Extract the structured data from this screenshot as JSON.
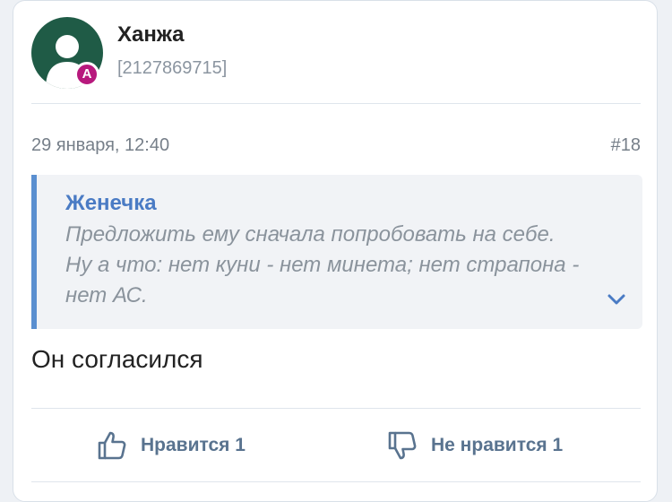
{
  "author": {
    "name": "Ханжа",
    "id": "[2127869715]",
    "badge": "A",
    "avatar_bg": "#1f5b46",
    "badge_color": "#b7197d"
  },
  "post": {
    "date": "29 января, 12:40",
    "number": "#18",
    "quote": {
      "author": "Женечка",
      "text": "Предложить ему сначала попробовать на себе. Ну а что: нет куни - нет минета; нет страпона - нет АС."
    },
    "text": "Он согласился"
  },
  "actions": {
    "like_label": "Нравится 1",
    "dislike_label": "Не нравится 1",
    "accent": "#59738f"
  }
}
